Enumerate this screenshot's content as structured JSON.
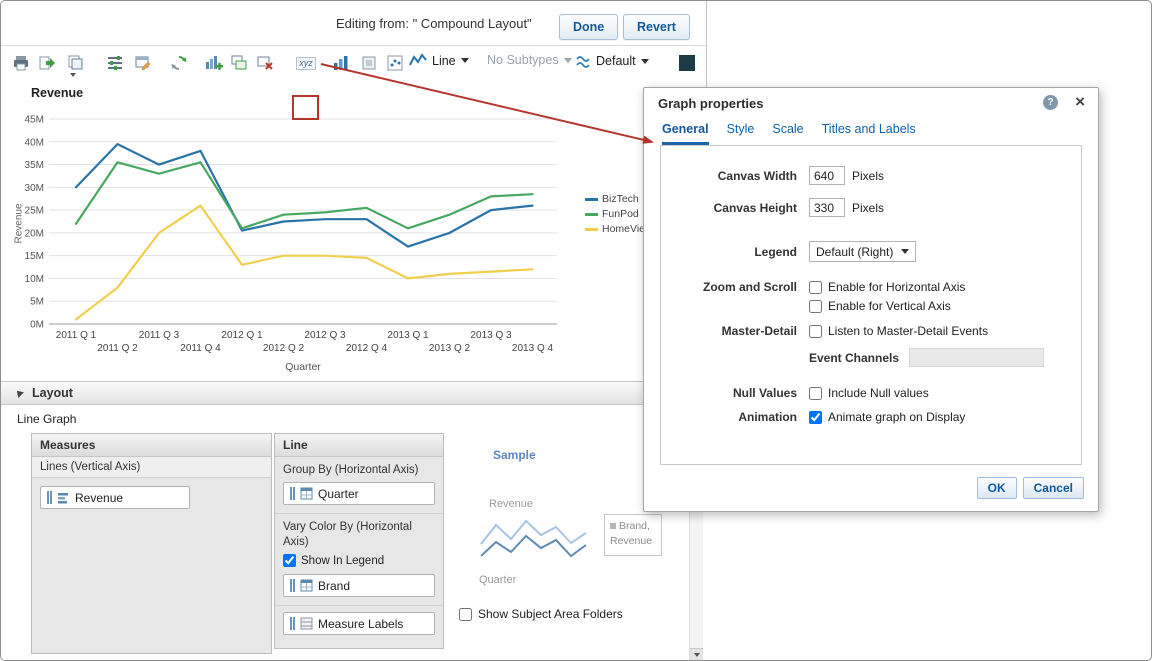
{
  "window": {
    "editing_label": "Editing from: \" Compound Layout\"",
    "done_button": "Done",
    "revert_button": "Revert"
  },
  "toolbar": {
    "xyz_icon_text": "xyz",
    "graph_type_label": "Line",
    "subtype_label": "No Subtypes",
    "style_label": "Default"
  },
  "colors": {
    "arrow_red": "#b3352b",
    "accent_blue": "#15589c",
    "tab_blue": "#0f62a8"
  },
  "chart_data": {
    "type": "line",
    "title": "Revenue",
    "ylabel": "Revenue",
    "xlabel": "Quarter",
    "ylim": [
      0,
      45
    ],
    "ytick_step": 5,
    "ytick_suffix": "M",
    "grid": true,
    "legend_position": "right",
    "categories": [
      "2011 Q 1",
      "2011 Q 2",
      "2011 Q 3",
      "2011 Q 4",
      "2012 Q 1",
      "2012 Q 2",
      "2012 Q 3",
      "2012 Q 4",
      "2013 Q 1",
      "2013 Q 2",
      "2013 Q 3",
      "2013 Q 4"
    ],
    "series": [
      {
        "name": "BizTech",
        "color": "#2873a8",
        "values": [
          30,
          39.5,
          35,
          38,
          20.5,
          22.5,
          23,
          23,
          17,
          20,
          25,
          26
        ]
      },
      {
        "name": "FunPod",
        "color": "#47a861",
        "values": [
          22,
          35.5,
          33,
          35.5,
          21,
          24,
          24.5,
          25.5,
          21,
          24,
          28,
          28.5
        ]
      },
      {
        "name": "HomeView",
        "color": "#f0cf4e",
        "values": [
          1,
          8,
          20,
          26,
          13,
          15,
          15,
          14.5,
          10,
          11,
          11.5,
          12
        ]
      }
    ]
  },
  "layout_panel": {
    "title": "Layout",
    "view_type": "Line Graph",
    "measures": {
      "title": "Measures",
      "section_label": "Lines (Vertical Axis)",
      "items": [
        "Revenue"
      ]
    },
    "line": {
      "title": "Line",
      "group_by_label": "Group By (Horizontal Axis)",
      "group_by_item": "Quarter",
      "vary_color_label": "Vary Color By (Horizontal Axis)",
      "show_in_legend_label": "Show In Legend",
      "show_in_legend_checked": true,
      "vary_color_item": "Brand",
      "measure_labels_item": "Measure Labels"
    },
    "sample": {
      "title": "Sample",
      "ylabel": "Revenue",
      "xlabel": "Quarter",
      "legend_line_1": "Brand,",
      "legend_line_2": "Revenue"
    },
    "show_subject_area_folders_label": "Show Subject Area Folders",
    "show_subject_area_folders_checked": false
  },
  "dialog": {
    "title": "Graph properties",
    "tabs": [
      "General",
      "Style",
      "Scale",
      "Titles and Labels"
    ],
    "active_tab": "General",
    "general": {
      "canvas_width_label": "Canvas Width",
      "canvas_width_value": "640",
      "canvas_width_unit": "Pixels",
      "canvas_height_label": "Canvas Height",
      "canvas_height_value": "330",
      "canvas_height_unit": "Pixels",
      "legend_label": "Legend",
      "legend_value": "Default (Right)",
      "zoom_label": "Zoom and Scroll",
      "zoom_horizontal_label": "Enable for Horizontal Axis",
      "zoom_horizontal_checked": false,
      "zoom_vertical_label": "Enable for Vertical Axis",
      "zoom_vertical_checked": false,
      "master_detail_label": "Master-Detail",
      "master_detail_check_label": "Listen to Master-Detail Events",
      "master_detail_checked": false,
      "event_channels_label": "Event Channels",
      "event_channels_value": "",
      "null_values_label": "Null Values",
      "null_values_check_label": "Include Null values",
      "null_values_checked": false,
      "animation_label": "Animation",
      "animation_check_label": "Animate graph on Display",
      "animation_checked": true
    },
    "ok_button": "OK",
    "cancel_button": "Cancel"
  }
}
